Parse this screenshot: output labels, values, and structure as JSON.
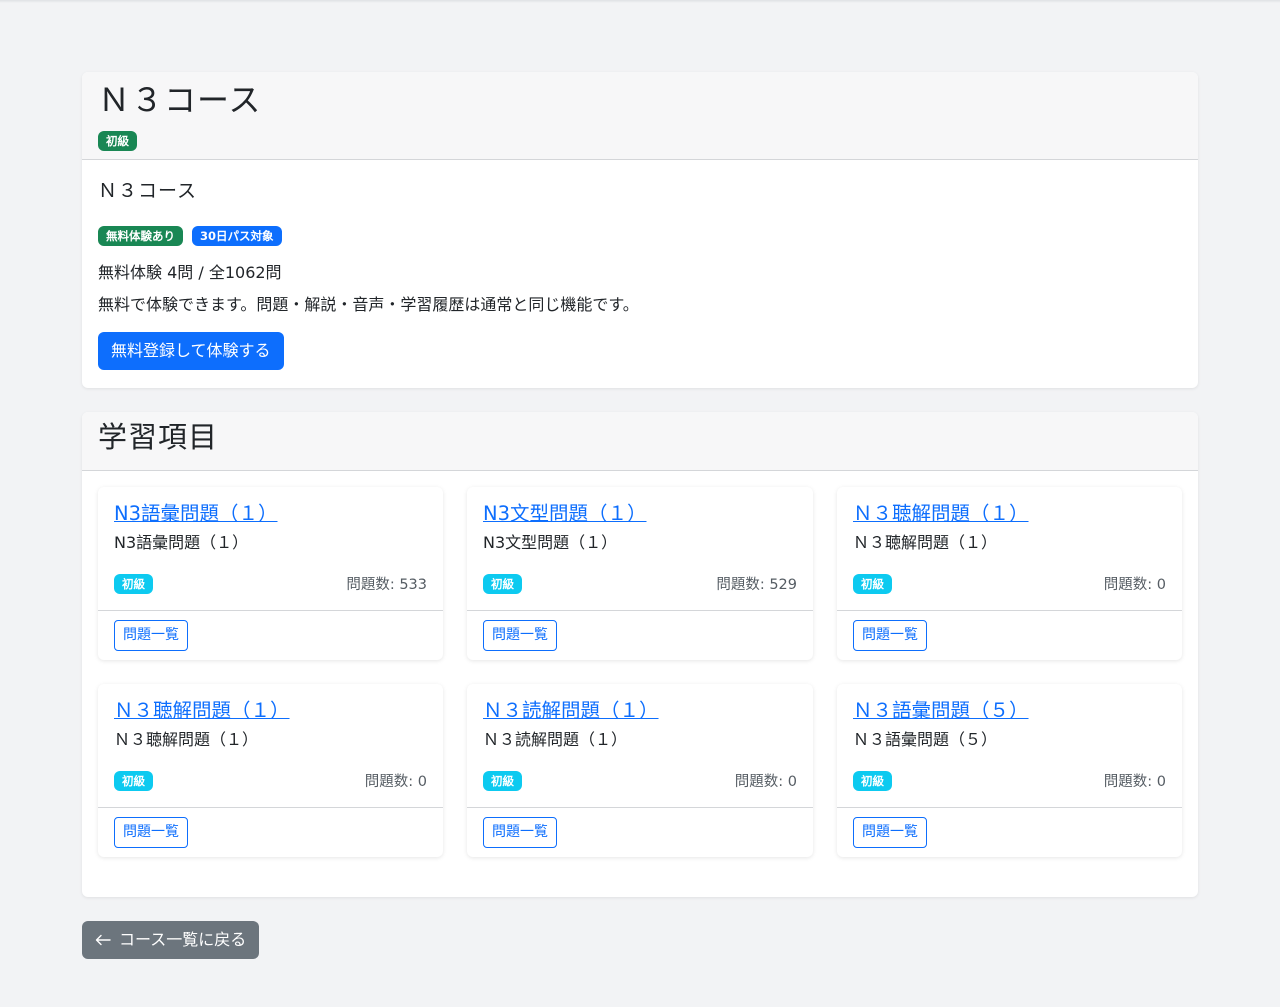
{
  "course": {
    "title": "Ｎ３コース",
    "level_badge": "初級",
    "subtitle": "Ｎ３コース",
    "badges": [
      "無料体験あり",
      "30日パス対象"
    ],
    "free_info": "無料体験 4問 / 全1062問",
    "free_desc": "無料で体験できます。問題・解説・音声・学習履歴は通常と同じ機能です。",
    "signup_button": "無料登録して体験する"
  },
  "study_items": {
    "heading": "学習項目",
    "items": [
      {
        "title": "N3語彙問題（１）",
        "subtitle": "N3語彙問題（１）",
        "level": "初級",
        "count": "問題数: 533",
        "button": "問題一覧"
      },
      {
        "title": "N3文型問題（１）",
        "subtitle": "N3文型問題（１）",
        "level": "初級",
        "count": "問題数: 529",
        "button": "問題一覧"
      },
      {
        "title": "Ｎ３聴解問題（１）",
        "subtitle": "Ｎ３聴解問題（１）",
        "level": "初級",
        "count": "問題数: 0",
        "button": "問題一覧"
      },
      {
        "title": "Ｎ３聴解問題（１）",
        "subtitle": "Ｎ３聴解問題（１）",
        "level": "初級",
        "count": "問題数: 0",
        "button": "問題一覧"
      },
      {
        "title": "Ｎ３読解問題（１）",
        "subtitle": "Ｎ３読解問題（１）",
        "level": "初級",
        "count": "問題数: 0",
        "button": "問題一覧"
      },
      {
        "title": "Ｎ３語彙問題（５）",
        "subtitle": "Ｎ３語彙問題（５）",
        "level": "初級",
        "count": "問題数: 0",
        "button": "問題一覧"
      }
    ]
  },
  "back_button": "コース一覧に戻る",
  "colors": {
    "primary": "#0d6efd",
    "success": "#198754",
    "info": "#0dcaf0",
    "secondary": "#6c757d",
    "background": "#f2f3f5"
  }
}
